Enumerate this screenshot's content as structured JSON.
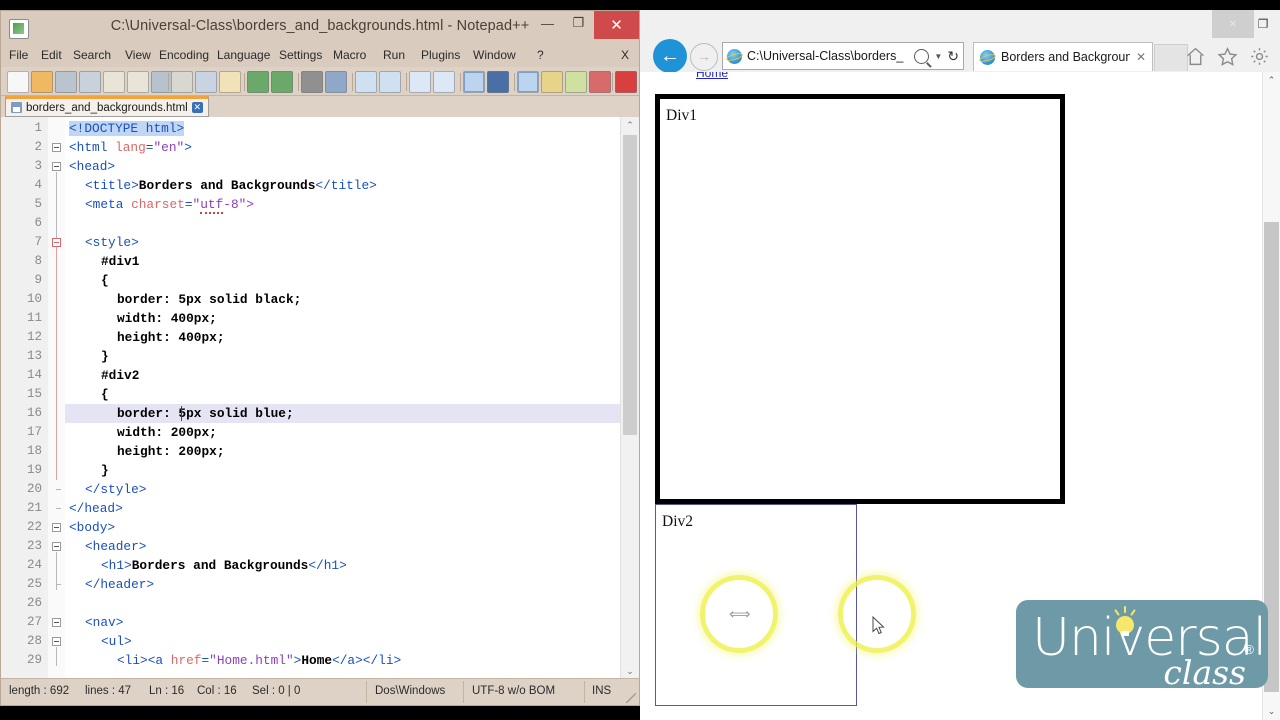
{
  "editor": {
    "title": "C:\\Universal-Class\\borders_and_backgrounds.html - Notepad++",
    "app_icon": "notepad-plus-plus-icon",
    "window_buttons": {
      "minimize": "—",
      "maximize": "❐",
      "close": "✕"
    },
    "menu": [
      "File",
      "Edit",
      "Search",
      "View",
      "Encoding",
      "Language",
      "Settings",
      "Macro",
      "Run",
      "Plugins",
      "Window",
      "?"
    ],
    "menu_close_label": "X",
    "tab": {
      "filename": "borders_and_backgrounds.html",
      "close_label": "✕",
      "save_icon": "floppy-disk-icon"
    },
    "toolbar_icons": [
      "new-file-icon",
      "open-folder-icon",
      "save-icon",
      "save-all-icon",
      "close-file-icon",
      "close-all-icon",
      "print-icon",
      "cut-icon",
      "copy-icon",
      "paste-icon",
      "undo-icon",
      "redo-icon",
      "find-icon",
      "replace-icon",
      "zoom-in-icon",
      "zoom-out-icon",
      "sync-vertical-icon",
      "sync-horizontal-icon",
      "word-wrap-icon",
      "show-all-chars-icon",
      "indent-guide-icon",
      "ui-theme-icon",
      "show-doc-map-icon",
      "function-list-icon",
      "record-macro-icon",
      "stop-macro-icon"
    ],
    "lines": [
      {
        "n": 1,
        "indent": 0,
        "tokens": [
          {
            "t": "<!DOCTYPE html>",
            "c": "tg sel"
          }
        ]
      },
      {
        "n": 2,
        "indent": 0,
        "tokens": [
          {
            "t": "<html ",
            "c": "tg"
          },
          {
            "t": "lang",
            "c": "at"
          },
          {
            "t": "=",
            "c": "tg"
          },
          {
            "t": "\"en\"",
            "c": "vl"
          },
          {
            "t": ">",
            "c": "tg"
          }
        ]
      },
      {
        "n": 3,
        "indent": 0,
        "tokens": [
          {
            "t": "<head>",
            "c": "tg"
          }
        ]
      },
      {
        "n": 4,
        "indent": 1,
        "tokens": [
          {
            "t": "<title>",
            "c": "tg"
          },
          {
            "t": "Borders and Backgrounds",
            "c": "tx"
          },
          {
            "t": "</title>",
            "c": "tg"
          }
        ]
      },
      {
        "n": 5,
        "indent": 1,
        "tokens": [
          {
            "t": "<meta ",
            "c": "tg"
          },
          {
            "t": "charset",
            "c": "at"
          },
          {
            "t": "=",
            "c": "tg"
          },
          {
            "t": "\"",
            "c": "vl"
          },
          {
            "t": "utf",
            "c": "vl squig"
          },
          {
            "t": "-8\">",
            "c": "vl"
          }
        ]
      },
      {
        "n": 6,
        "indent": 0,
        "tokens": []
      },
      {
        "n": 7,
        "indent": 1,
        "tokens": [
          {
            "t": "<style>",
            "c": "tg"
          }
        ]
      },
      {
        "n": 8,
        "indent": 2,
        "tokens": [
          {
            "t": "#div1",
            "c": "cs"
          }
        ]
      },
      {
        "n": 9,
        "indent": 2,
        "tokens": [
          {
            "t": "{",
            "c": "cs"
          }
        ]
      },
      {
        "n": 10,
        "indent": 3,
        "tokens": [
          {
            "t": "border: 5px solid black;",
            "c": "cs"
          }
        ]
      },
      {
        "n": 11,
        "indent": 3,
        "tokens": [
          {
            "t": "width: 400px;",
            "c": "cs"
          }
        ]
      },
      {
        "n": 12,
        "indent": 3,
        "tokens": [
          {
            "t": "height: 400px;",
            "c": "cs"
          }
        ]
      },
      {
        "n": 13,
        "indent": 2,
        "tokens": [
          {
            "t": "}",
            "c": "cs"
          }
        ]
      },
      {
        "n": 14,
        "indent": 2,
        "tokens": [
          {
            "t": "#div2",
            "c": "cs"
          }
        ]
      },
      {
        "n": 15,
        "indent": 2,
        "tokens": [
          {
            "t": "{",
            "c": "cs"
          }
        ]
      },
      {
        "n": 16,
        "indent": 3,
        "tokens": [
          {
            "t": "border: 5px solid blue;",
            "c": "cs"
          }
        ],
        "current": true
      },
      {
        "n": 17,
        "indent": 3,
        "tokens": [
          {
            "t": "width: 200px;",
            "c": "cs"
          }
        ]
      },
      {
        "n": 18,
        "indent": 3,
        "tokens": [
          {
            "t": "height: 200px;",
            "c": "cs"
          }
        ]
      },
      {
        "n": 19,
        "indent": 2,
        "tokens": [
          {
            "t": "}",
            "c": "cs"
          }
        ]
      },
      {
        "n": 20,
        "indent": 1,
        "tokens": [
          {
            "t": "</style>",
            "c": "tg"
          }
        ]
      },
      {
        "n": 21,
        "indent": 0,
        "tokens": [
          {
            "t": "</head>",
            "c": "tg"
          }
        ]
      },
      {
        "n": 22,
        "indent": 0,
        "tokens": [
          {
            "t": "<body>",
            "c": "tg"
          }
        ]
      },
      {
        "n": 23,
        "indent": 1,
        "tokens": [
          {
            "t": "<header>",
            "c": "tg"
          }
        ]
      },
      {
        "n": 24,
        "indent": 2,
        "tokens": [
          {
            "t": "<h1>",
            "c": "tg"
          },
          {
            "t": "Borders and Backgrounds",
            "c": "tx"
          },
          {
            "t": "</h1>",
            "c": "tg"
          }
        ]
      },
      {
        "n": 25,
        "indent": 1,
        "tokens": [
          {
            "t": "</header>",
            "c": "tg"
          }
        ]
      },
      {
        "n": 26,
        "indent": 0,
        "tokens": []
      },
      {
        "n": 27,
        "indent": 1,
        "tokens": [
          {
            "t": "<nav>",
            "c": "tg"
          }
        ]
      },
      {
        "n": 28,
        "indent": 2,
        "tokens": [
          {
            "t": "<ul>",
            "c": "tg"
          }
        ]
      },
      {
        "n": 29,
        "indent": 3,
        "tokens": [
          {
            "t": "<li><a ",
            "c": "tg"
          },
          {
            "t": "href",
            "c": "at"
          },
          {
            "t": "=",
            "c": "tg"
          },
          {
            "t": "\"Home.html\"",
            "c": "vl"
          },
          {
            "t": ">",
            "c": "tg"
          },
          {
            "t": "Home",
            "c": "tx"
          },
          {
            "t": "</a></li>",
            "c": "tg"
          }
        ]
      }
    ],
    "status": {
      "length": "length : 692",
      "lines": "lines : 47",
      "ln": "Ln : 16",
      "col": "Col : 16",
      "sel": "Sel : 0 | 0",
      "eol": "Dos\\Windows",
      "encoding": "UTF-8 w/o BOM",
      "mode": "INS"
    }
  },
  "browser": {
    "window_buttons": {
      "minimize": "—",
      "maximize": "❐",
      "close": "✕"
    },
    "back_label": "←",
    "forward_label": "→",
    "address": "C:\\Universal-Class\\borders_",
    "search_icon": "magnifier-icon",
    "dropdown_icon": "chevron-down-icon",
    "refresh_label": "↻",
    "tab": {
      "title": "Borders and Backgrounds",
      "close_label": "✕",
      "favicon": "ie-logo-icon"
    },
    "tools": [
      "home-icon",
      "favorites-star-icon",
      "settings-gear-icon"
    ],
    "page": {
      "nav_link": "Home",
      "div1_label": "Div1",
      "div2_label": "Div2",
      "div1_border": "#000000",
      "div2_border": "#5555aa",
      "scroll_up": "⌃",
      "scroll_down": "⌄"
    }
  },
  "overlay": {
    "highlight_color": "#eef03c",
    "circles": [
      {
        "name": "resize-cursor-highlight",
        "cursor": "horizontal-resize-cursor"
      },
      {
        "name": "mouse-pointer-highlight",
        "cursor": "arrow-pointer-cursor"
      }
    ]
  },
  "logo": {
    "word": "Universal",
    "sub": "class",
    "registered": "®",
    "bg": "#6d9aa6",
    "bulb_color": "#f6e86a"
  }
}
